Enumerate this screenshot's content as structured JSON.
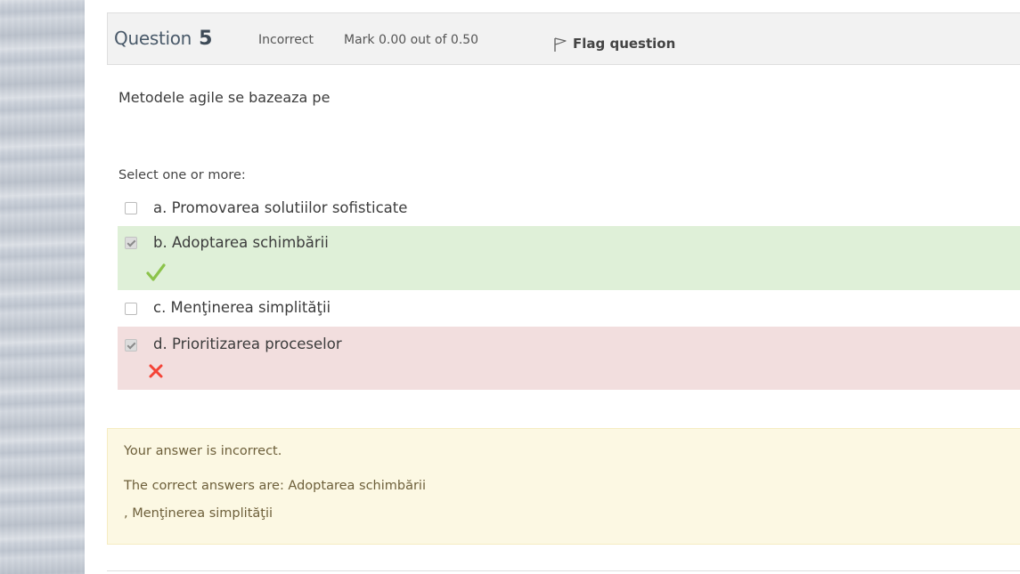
{
  "header": {
    "question_word": "Question",
    "question_number": "5",
    "state": "Incorrect",
    "grade": "Mark 0.00 out of 0.50",
    "flag_label": "Flag question"
  },
  "question": {
    "text": "Metodele agile se bazeaza pe",
    "prompt": "Select one or more:"
  },
  "answers": [
    {
      "label": "a. Promovarea solutiilor sofisticate",
      "checked": false,
      "status": "none"
    },
    {
      "label": "b. Adoptarea schimbării",
      "checked": true,
      "status": "correct"
    },
    {
      "label": "c. Menţinerea simplităţii",
      "checked": false,
      "status": "none"
    },
    {
      "label": "d. Prioritizarea proceselor",
      "checked": true,
      "status": "incorrect"
    }
  ],
  "feedback": {
    "result": "Your answer is incorrect.",
    "correct_line1": "The correct answers are: Adoptarea schimbării",
    "correct_line2": ", Menţinerea simplităţii"
  },
  "colors": {
    "correct_bg": "#dff0d8",
    "incorrect_bg": "#f2dede",
    "feedback_bg": "#fcf8e3",
    "check_green": "#8bc34a",
    "cross_red": "#f44336"
  },
  "icons": {
    "flag": "flag-icon",
    "correct": "checkmark-icon",
    "incorrect": "cross-icon"
  }
}
